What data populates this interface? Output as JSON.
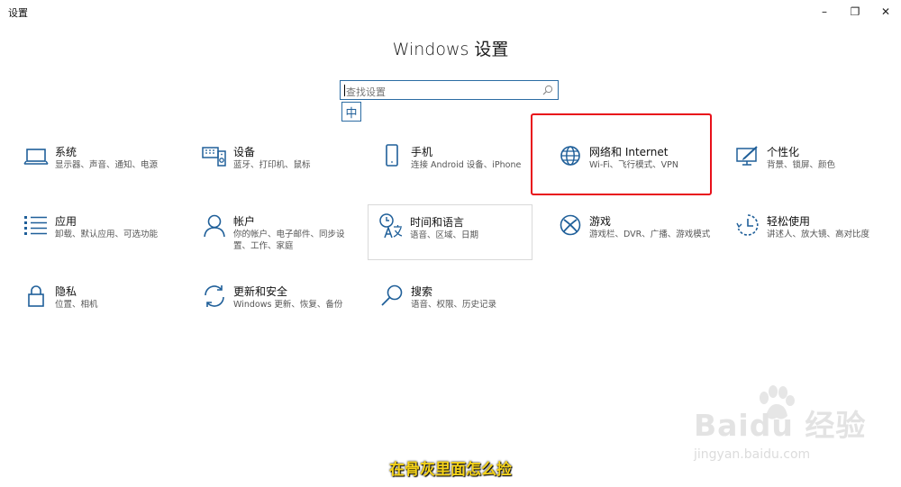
{
  "window": {
    "title": "设置",
    "minimize_glyph": "–",
    "restore_glyph": "❐",
    "close_glyph": "✕"
  },
  "page": {
    "heading": "Windows 设置"
  },
  "search": {
    "placeholder": "查找设置",
    "ime_label": "中"
  },
  "tiles": [
    {
      "name": "系统",
      "desc": "显示器、声音、通知、电源",
      "icon": "laptop-icon"
    },
    {
      "name": "设备",
      "desc": "蓝牙、打印机、鼠标",
      "icon": "keyboard-speaker-icon"
    },
    {
      "name": "手机",
      "desc": "连接 Android 设备、iPhone",
      "icon": "phone-icon"
    },
    {
      "name": "网络和 Internet",
      "desc": "Wi-Fi、飞行模式、VPN",
      "icon": "globe-icon"
    },
    {
      "name": "个性化",
      "desc": "背景、锁屏、颜色",
      "icon": "paint-monitor-icon"
    },
    {
      "name": "应用",
      "desc": "卸载、默认应用、可选功能",
      "icon": "apps-list-icon"
    },
    {
      "name": "帐户",
      "desc": "你的帐户、电子邮件、同步设置、工作、家庭",
      "icon": "person-icon"
    },
    {
      "name": "时间和语言",
      "desc": "语音、区域、日期",
      "icon": "time-language-icon"
    },
    {
      "name": "游戏",
      "desc": "游戏栏、DVR、广播、游戏模式",
      "icon": "xbox-icon"
    },
    {
      "name": "轻松使用",
      "desc": "讲述人、放大镜、高对比度",
      "icon": "ease-of-access-icon"
    },
    {
      "name": "隐私",
      "desc": "位置、相机",
      "icon": "lock-icon"
    },
    {
      "name": "更新和安全",
      "desc": "Windows 更新、恢复、备份",
      "icon": "sync-icon"
    },
    {
      "name": "搜索",
      "desc": "语音、权限、历史记录",
      "icon": "search-icon"
    }
  ],
  "overlay": {
    "caption": "在骨灰里面怎么捡",
    "watermark_logo": "Baidu 经验",
    "watermark_url": "jingyan.baidu.com"
  },
  "colors": {
    "accent": "#2b6ca3",
    "icon": "#1f5f99",
    "highlight": "#e8101a",
    "caption": "#f4d21a"
  }
}
